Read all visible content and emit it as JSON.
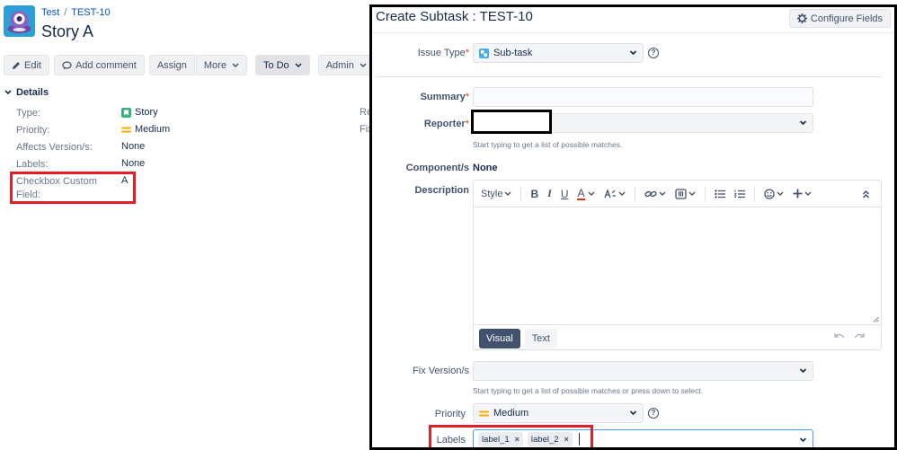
{
  "issue": {
    "breadcrumb": {
      "project": "Test",
      "separator": "/",
      "key": "TEST-10"
    },
    "title": "Story A",
    "toolbar": {
      "edit": "Edit",
      "add_comment": "Add comment",
      "assign": "Assign",
      "more": "More",
      "status": "To Do",
      "admin": "Admin"
    },
    "details": {
      "heading": "Details",
      "fields": [
        {
          "label": "Type:",
          "value": "Story",
          "icon": "story-icon"
        },
        {
          "label": "Priority:",
          "value": "Medium",
          "icon": "priority-medium-icon"
        },
        {
          "label": "Affects Version/s:",
          "value": "None"
        },
        {
          "label": "Labels:",
          "value": "None"
        },
        {
          "label": "Checkbox Custom Field:",
          "value": "A"
        }
      ],
      "cut_labels": [
        "Re",
        "Fix"
      ]
    }
  },
  "dialog": {
    "title": "Create Subtask : TEST-10",
    "configure_fields": "Configure Fields",
    "issue_type": {
      "label": "Issue Type",
      "required": "*",
      "value": "Sub-task",
      "help": "?"
    },
    "summary": {
      "label": "Summary",
      "required": "*",
      "value": ""
    },
    "reporter": {
      "label": "Reporter",
      "required": "*",
      "hint": "Start typing to get a list of possible matches."
    },
    "components": {
      "label": "Component/s",
      "value": "None"
    },
    "description": {
      "label": "Description",
      "toolbar": {
        "style": "Style",
        "bold": "B",
        "italic": "I",
        "underline": "U",
        "text_color": "A"
      },
      "modes": {
        "visual": "Visual",
        "text": "Text"
      }
    },
    "fix_versions": {
      "label": "Fix Version/s",
      "hint": "Start typing to get a list of possible matches or press down to select."
    },
    "priority": {
      "label": "Priority",
      "value": "Medium",
      "help": "?"
    },
    "labels": {
      "label": "Labels",
      "tags": [
        "label_1",
        "label_2"
      ],
      "remove_glyph": "×"
    }
  },
  "colors": {
    "link": "#0052cc",
    "highlight_box": "#e01f26",
    "story_icon": "#36b37e",
    "subtask_icon": "#4bade8",
    "priority_medium": "#ffab00"
  }
}
